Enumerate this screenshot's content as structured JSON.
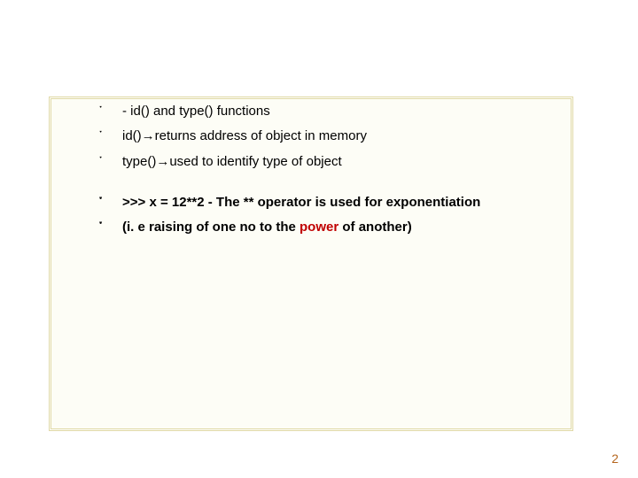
{
  "bullets": {
    "b1": "- id() and type() functions",
    "b2_pre": "id()",
    "b2_arrow": "→",
    "b2_post": "returns address of object in memory",
    "b3_pre": "type()",
    "b3_arrow": "→",
    "b3_post": "used to identify type of object",
    "b4": ">>> x = 12**2  - The ** operator is used for exponentiation",
    "b5_pre": "(i. e raising of one no to the ",
    "b5_pow": "power",
    "b5_post": " of another)"
  },
  "glyph": "་",
  "slide_number": "2"
}
